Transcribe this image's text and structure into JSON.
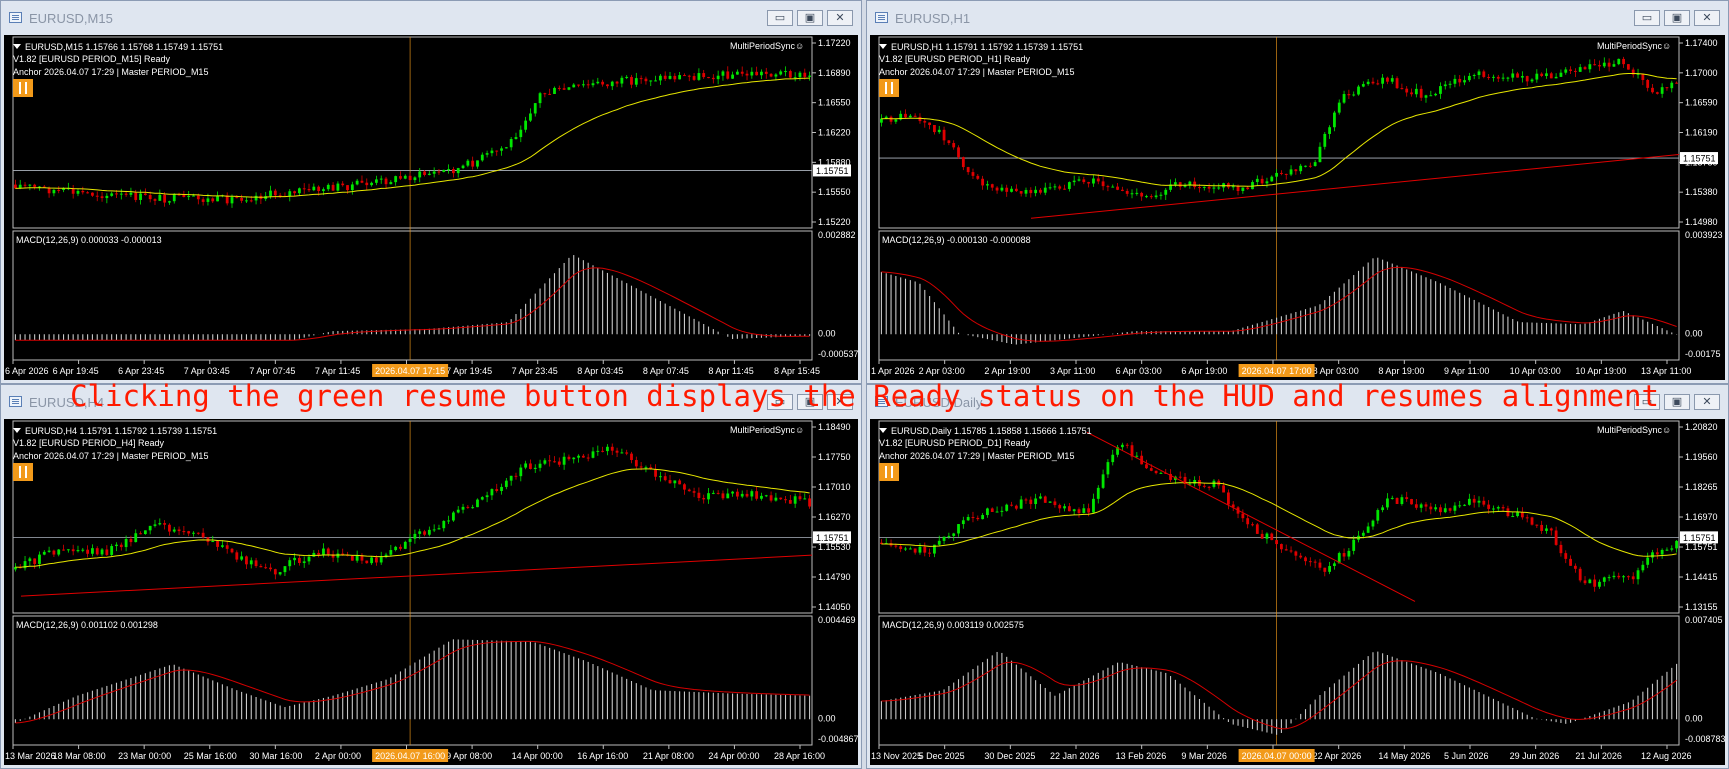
{
  "colors": {
    "up": "#00e600",
    "down": "#e00000",
    "ma": "#e6e600",
    "signal": "#d40000",
    "hist": "#c8c8c8",
    "trend": "#e00000",
    "cross": "#f29a1a",
    "priceTag": "#ffffff"
  },
  "window_buttons": {
    "minimize": "▭",
    "restore": "▣",
    "close": "✕"
  },
  "banner": "Clicking the green resume button displays the Ready status on the HUD and resumes alignment",
  "windows": [
    {
      "title": "EURUSD,M15",
      "hud_line1": "EURUSD,M15  1.15766 1.15768 1.15749 1.15751",
      "hud_line2": "V1.82 [EURUSD PERIOD_M15] Ready",
      "hud_line3": "Anchor 2026.04.07 17:29 | Master PERIOD_M15",
      "indicator": "MultiPeriodSync☺",
      "macd_label": "MACD(12,26,9) 0.000033 -0.000013",
      "price_ticks": [
        "1.17220",
        "1.16890",
        "1.16550",
        "1.16220",
        "1.15880",
        "1.15550",
        "1.15220"
      ],
      "current_price": "1.15751",
      "macd_ticks": [
        "0.002882",
        "0.00",
        "-0.000537"
      ],
      "time_labels": [
        "6 Apr 2026",
        "6 Apr 19:45",
        "6 Apr 23:45",
        "7 Apr 03:45",
        "7 Apr 07:45",
        "7 Apr 11:45",
        "",
        "7 Apr 19:45",
        "7 Apr 23:45",
        "8 Apr 03:45",
        "8 Apr 07:45",
        "8 Apr 11:45",
        "8 Apr 15:45"
      ],
      "cursor_label": "2026.04.07 17:15"
    },
    {
      "title": "EURUSD,H1",
      "hud_line1": "EURUSD,H1  1.15791 1.15792 1.15739 1.15751",
      "hud_line2": "V1.82 [EURUSD PERIOD_H1] Ready",
      "hud_line3": "Anchor 2026.04.07 17:29 | Master PERIOD_M15",
      "indicator": "MultiPeriodSync☺",
      "macd_label": "MACD(12,26,9) -0.000130 -0.000088",
      "price_ticks": [
        "1.17400",
        "1.17000",
        "1.16590",
        "1.16190",
        "1.15780",
        "1.15380",
        "1.14980"
      ],
      "current_price": "1.15751",
      "macd_ticks": [
        "0.003923",
        "0.00",
        "-0.00175"
      ],
      "time_labels": [
        "1 Apr 2026",
        "2 Apr 03:00",
        "2 Apr 19:00",
        "3 Apr 11:00",
        "6 Apr 03:00",
        "6 Apr 19:00",
        "",
        "8 Apr 03:00",
        "8 Apr 19:00",
        "9 Apr 11:00",
        "10 Apr 03:00",
        "10 Apr 19:00",
        "13 Apr 11:00"
      ],
      "cursor_label": "2026.04.07 17:00"
    },
    {
      "title": "EURUSD,H4",
      "hud_line1": "EURUSD,H4  1.15791 1.15792 1.15739 1.15751",
      "hud_line2": "V1.82 [EURUSD PERIOD_H4] Ready",
      "hud_line3": "Anchor 2026.04.07 17:29 | Master PERIOD_M15",
      "indicator": "MultiPeriodSync☺",
      "macd_label": "MACD(12,26,9) 0.001102 0.001298",
      "price_ticks": [
        "1.18490",
        "1.17750",
        "1.17010",
        "1.16270",
        "1.15530",
        "1.14790",
        "1.14050"
      ],
      "current_price": "1.15751",
      "macd_ticks": [
        "0.004469",
        "0.00",
        "-0.004867"
      ],
      "time_labels": [
        "13 Mar 2026",
        "18 Mar 08:00",
        "23 Mar 00:00",
        "25 Mar 16:00",
        "30 Mar 16:00",
        "2 Apr 00:00",
        "",
        "9 Apr 08:00",
        "14 Apr 00:00",
        "16 Apr 16:00",
        "21 Apr 08:00",
        "24 Apr 00:00",
        "28 Apr 16:00"
      ],
      "cursor_label": "2026.04.07 16:00"
    },
    {
      "title": "EURUSD,Daily",
      "hud_line1": "EURUSD,Daily  1.15785 1.15858 1.15666 1.15751",
      "hud_line2": "V1.82 [EURUSD PERIOD_D1] Ready",
      "hud_line3": "Anchor 2026.04.07 17:29 | Master PERIOD_M15",
      "indicator": "MultiPeriodSync☺",
      "macd_label": "MACD(12,26,9) 0.003119 0.002575",
      "price_ticks": [
        "1.20820",
        "1.19560",
        "1.18265",
        "1.16970",
        "1.15751",
        "1.14415",
        "1.13155"
      ],
      "current_price": "1.15751",
      "macd_ticks": [
        "0.007405",
        "0.00",
        "-0.008783"
      ],
      "time_labels": [
        "13 Nov 2025",
        "5 Dec 2025",
        "30 Dec 2025",
        "22 Jan 2026",
        "13 Feb 2026",
        "9 Mar 2026",
        "",
        "22 Apr 2026",
        "14 May 2026",
        "5 Jun 2026",
        "29 Jun 2026",
        "21 Jul 2026",
        "12 Aug 2026"
      ],
      "cursor_label": "2026.04.07 00:00"
    }
  ]
}
